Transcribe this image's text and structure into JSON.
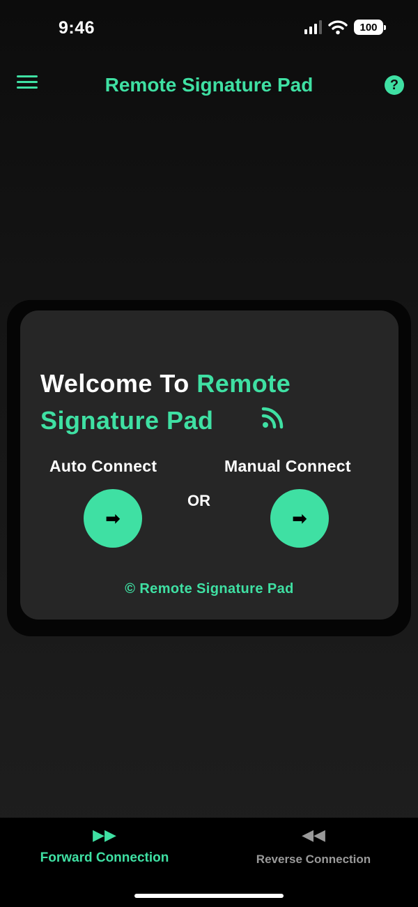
{
  "status_bar": {
    "time": "9:46",
    "battery": "100"
  },
  "header": {
    "title": "Remote Signature Pad",
    "help_label": "?"
  },
  "card": {
    "welcome_prefix": "Welcome To ",
    "welcome_app_name": "Remote Signature Pad",
    "auto_connect_label": "Auto Connect",
    "or_label": "OR",
    "manual_connect_label": "Manual Connect",
    "arrow_glyph": "➡",
    "copyright": "© Remote Signature Pad"
  },
  "tabs": [
    {
      "label": "Forward Connection",
      "icon": "fast-forward-icon",
      "glyph": "▶▶",
      "active": true
    },
    {
      "label": "Reverse Connection",
      "icon": "rewind-icon",
      "glyph": "◀◀",
      "active": false
    }
  ],
  "colors": {
    "accent": "#3fe0a3",
    "inactive_tab": "#9a9a9a",
    "card": "#262626"
  }
}
